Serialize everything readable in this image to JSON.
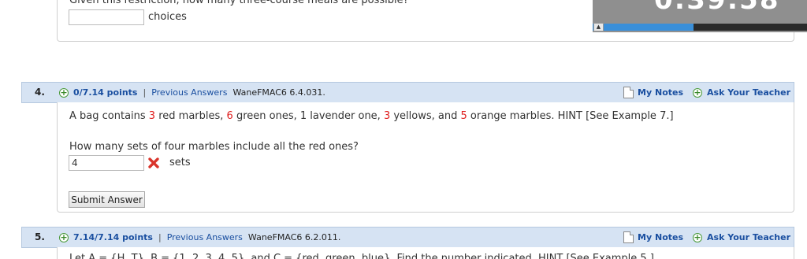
{
  "prev_question": {
    "text": "Given this restriction, how many three-course meals are possible?",
    "input_value": "",
    "unit_label": "choices"
  },
  "timer": {
    "text": "0:39:58",
    "progress_fraction": 0.47,
    "toggle_glyph": "▲"
  },
  "q4": {
    "number": "4.",
    "points": "0/7.14 points",
    "separator": "|",
    "previous_answers": "Previous Answers",
    "reference": "WaneFMAC6 6.4.031.",
    "my_notes": "My Notes",
    "ask_teacher": "Ask Your Teacher",
    "problem": {
      "p1": "A bag contains ",
      "n_red": "3",
      "p2": " red marbles, ",
      "n_green": "6",
      "p3": " green ones, 1 lavender one, ",
      "n_yellow": "3",
      "p4": " yellows, and ",
      "n_orange": "5",
      "p5": " orange marbles. HINT [See Example 7.]"
    },
    "sub_question": "How many sets of four marbles include all the red ones?",
    "answer_value": "4",
    "answer_status_icon": "incorrect-x-icon",
    "unit_label": "sets",
    "submit_label": "Submit Answer"
  },
  "q5": {
    "number": "5.",
    "points": "7.14/7.14 points",
    "separator": "|",
    "previous_answers": "Previous Answers",
    "reference": "WaneFMAC6 6.2.011.",
    "my_notes": "My Notes",
    "ask_teacher": "Ask Your Teacher",
    "partial_text": "Let A = {H, T}, B = {1, 2, 3, 4, 5}, and C = {red, green, blue}. Find the number indicated. HINT [See Example 5.]"
  },
  "colors": {
    "header_bg": "#d6e3f3",
    "link_blue": "#1a4fa0",
    "highlight_red": "#e02020",
    "timer_bg": "#8f8f8f",
    "timer_bar": "#3a8fd9"
  }
}
